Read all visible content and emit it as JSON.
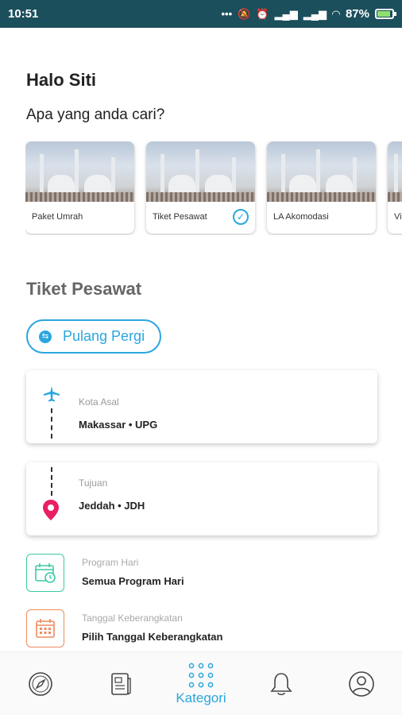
{
  "status": {
    "time": "10:51",
    "battery": "87%"
  },
  "greeting": "Halo Siti",
  "question": "Apa yang anda cari?",
  "categories": [
    {
      "label": "Paket Umrah",
      "selected": false
    },
    {
      "label": "Tiket Pesawat",
      "selected": true
    },
    {
      "label": "LA Akomodasi",
      "selected": false
    },
    {
      "label": "Vi",
      "selected": false
    }
  ],
  "section_title": "Tiket Pesawat",
  "trip_type": "Pulang Pergi",
  "origin": {
    "label": "Kota Asal",
    "value": "Makassar • UPG"
  },
  "destination": {
    "label": "Tujuan",
    "value": "Jeddah • JDH"
  },
  "program": {
    "label": "Program Hari",
    "value": "Semua Program Hari"
  },
  "departure": {
    "label": "Tanggal Keberangkatan",
    "value": "Pilih Tanggal Keberangkatan"
  },
  "nav": {
    "active_label": "Kategori"
  },
  "colors": {
    "accent": "#2ba6df",
    "statusbar": "#1c4f5c",
    "pin": "#e91e63",
    "program_icon": "#3cc9a4",
    "date_icon": "#f08a5d"
  }
}
